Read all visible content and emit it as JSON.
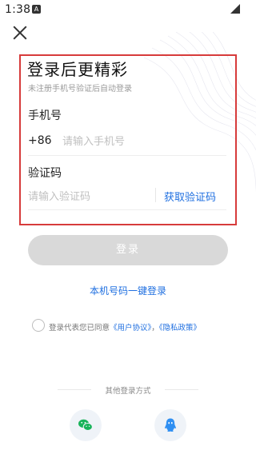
{
  "status_bar": {
    "time": "1:38",
    "app_icon": "A"
  },
  "header": {
    "close_icon": "close-icon"
  },
  "login": {
    "title": "登录后更精彩",
    "subtitle": "未注册手机号验证后自动登录",
    "phone_label": "手机号",
    "country_code": "+86",
    "phone_placeholder": "请输入手机号",
    "code_label": "验证码",
    "code_placeholder": "请输入验证码",
    "get_code": "获取验证码",
    "login_button": "登录",
    "one_click_login": "本机号码一键登录"
  },
  "agreement": {
    "prefix": "登录代表您已同意",
    "user_agreement": "《用户协议》",
    "separator": "，",
    "privacy_policy": "《隐私政策》"
  },
  "other_login": {
    "title": "其他登录方式",
    "options": [
      {
        "name": "wechat",
        "icon": "wechat-icon",
        "color": "#19b35a"
      },
      {
        "name": "qq",
        "icon": "qq-icon",
        "color": "#2f8ff2"
      }
    ]
  },
  "colors": {
    "accent": "#1f6fe0",
    "highlight_border": "#d73b3b",
    "disabled_button": "#d9d9d9"
  }
}
